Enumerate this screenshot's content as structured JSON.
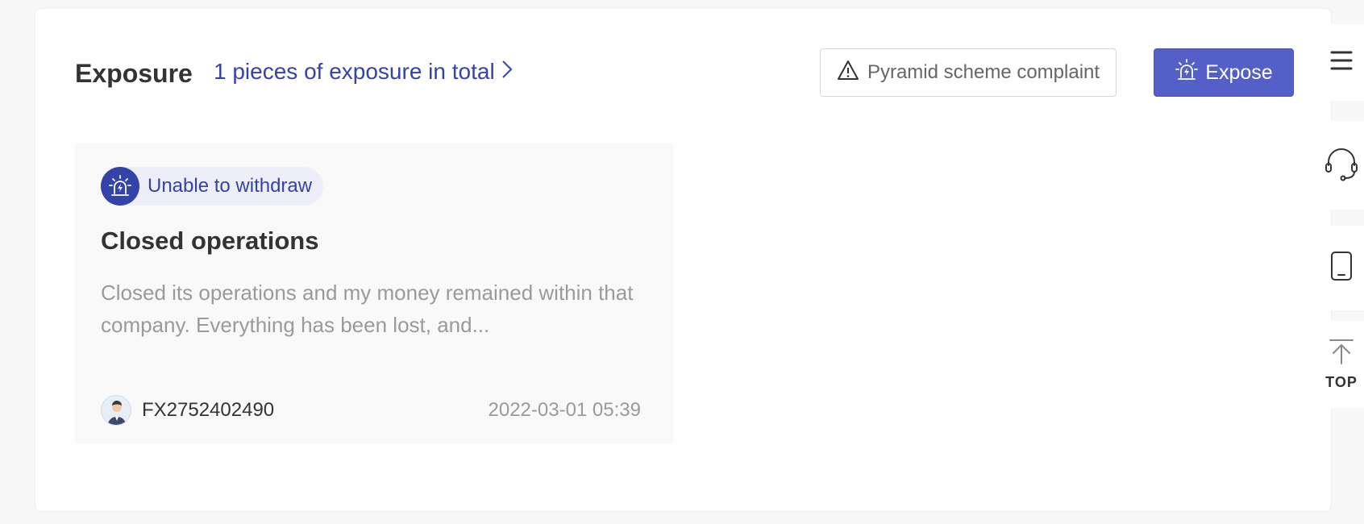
{
  "header": {
    "title": "Exposure",
    "summary_link": "1 pieces of exposure in total",
    "complaint_button": "Pyramid scheme complaint",
    "expose_button": "Expose"
  },
  "card": {
    "tag": "Unable to withdraw",
    "title": "Closed operations",
    "body": "Closed its operations and my money remained within that company. Everything has been lost, and...",
    "user": "FX2752402490",
    "date": "2022-03-01 05:39"
  },
  "side_bar": {
    "items": [
      {
        "icon": "menu-icon"
      },
      {
        "icon": "headset-icon"
      },
      {
        "icon": "phone-icon"
      },
      {
        "icon": "arrow-up-icon",
        "label": "TOP"
      }
    ]
  },
  "colors": {
    "accent": "#3443a8",
    "button_primary": "#5460c7",
    "muted_text": "#9a9a9a",
    "card_bg": "#f9f9fa"
  }
}
